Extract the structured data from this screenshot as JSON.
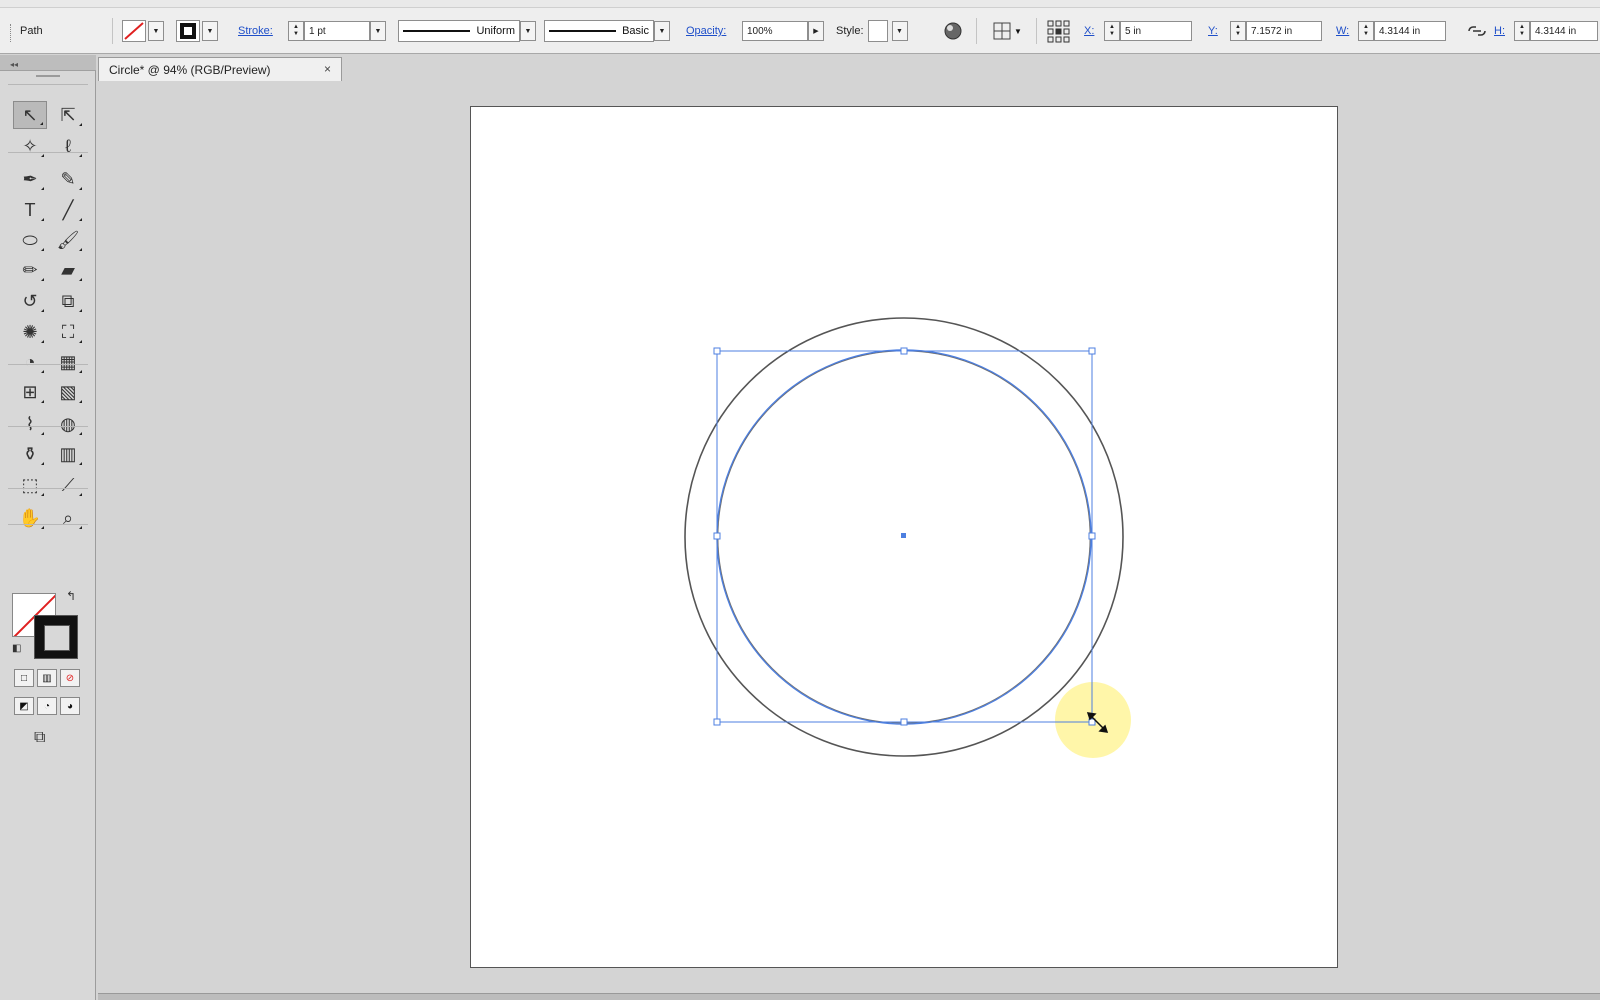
{
  "control_bar": {
    "selection_type": "Path",
    "stroke_label": "Stroke:",
    "stroke_weight": "1 pt",
    "variable_width": "Uniform",
    "brush": "Basic",
    "opacity_label": "Opacity:",
    "opacity_value": "100%",
    "style_label": "Style:",
    "x_label": "X:",
    "x_value": "5 in",
    "y_label": "Y:",
    "y_value": "7.1572 in",
    "w_label": "W:",
    "w_value": "4.3144 in",
    "h_label": "H:",
    "h_value": "4.3144 in"
  },
  "document": {
    "tab_title": "Circle* @ 94% (RGB/Preview)",
    "close_glyph": "×"
  },
  "tools": [
    {
      "name": "selection-tool",
      "glyph": "↖",
      "active": true
    },
    {
      "name": "direct-selection-tool",
      "glyph": "⇱"
    },
    {
      "name": "magic-wand-tool",
      "glyph": "✧"
    },
    {
      "name": "lasso-tool",
      "glyph": "ℓ"
    },
    {
      "name": "pen-tool",
      "glyph": "✒"
    },
    {
      "name": "curvature-tool",
      "glyph": "✎"
    },
    {
      "name": "type-tool",
      "glyph": "T"
    },
    {
      "name": "line-segment-tool",
      "glyph": "╱"
    },
    {
      "name": "ellipse-tool",
      "glyph": "⬭"
    },
    {
      "name": "paintbrush-tool",
      "glyph": "🖌"
    },
    {
      "name": "pencil-tool",
      "glyph": "✏"
    },
    {
      "name": "eraser-tool",
      "glyph": "▰"
    },
    {
      "name": "rotate-tool",
      "glyph": "↺"
    },
    {
      "name": "scale-tool",
      "glyph": "⧉"
    },
    {
      "name": "warp-tool",
      "glyph": "✺"
    },
    {
      "name": "free-transform-tool",
      "glyph": "⛶"
    },
    {
      "name": "shape-builder-tool",
      "glyph": "◔"
    },
    {
      "name": "perspective-grid-tool",
      "glyph": "▦"
    },
    {
      "name": "mesh-tool",
      "glyph": "⊞"
    },
    {
      "name": "gradient-tool",
      "glyph": "▧"
    },
    {
      "name": "eyedropper-tool",
      "glyph": "⌇"
    },
    {
      "name": "blend-tool",
      "glyph": "◍"
    },
    {
      "name": "symbol-sprayer-tool",
      "glyph": "⚱"
    },
    {
      "name": "column-graph-tool",
      "glyph": "▥"
    },
    {
      "name": "artboard-tool",
      "glyph": "⬚"
    },
    {
      "name": "slice-tool",
      "glyph": "⟋"
    },
    {
      "name": "hand-tool",
      "glyph": "✋"
    },
    {
      "name": "zoom-tool",
      "glyph": "⌕"
    }
  ],
  "colors": {
    "selection_blue": "#4d7fe0",
    "path_gray": "#444444",
    "cursor_highlight": "#fff59a"
  }
}
